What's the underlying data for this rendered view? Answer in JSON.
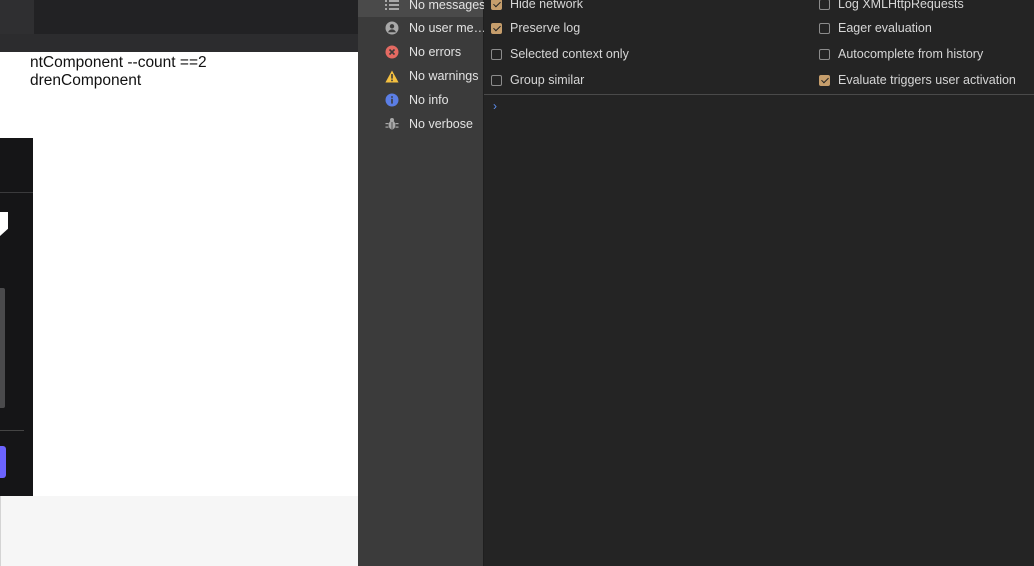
{
  "webpage": {
    "lines": [
      "ntComponent --count ==2",
      "drenComponent"
    ]
  },
  "console_sidebar": {
    "items": [
      {
        "label": "No messages",
        "icon": "list-icon"
      },
      {
        "label": "No user me…",
        "icon": "user-icon"
      },
      {
        "label": "No errors",
        "icon": "error-icon"
      },
      {
        "label": "No warnings",
        "icon": "warning-icon"
      },
      {
        "label": "No info",
        "icon": "info-icon"
      },
      {
        "label": "No verbose",
        "icon": "bug-icon"
      }
    ]
  },
  "settings": {
    "left": [
      {
        "label": "Hide network",
        "checked": true
      },
      {
        "label": "Preserve log",
        "checked": true
      },
      {
        "label": "Selected context only",
        "checked": false
      },
      {
        "label": "Group similar",
        "checked": false
      }
    ],
    "right": [
      {
        "label": "Log XMLHttpRequests",
        "checked": false
      },
      {
        "label": "Eager evaluation",
        "checked": false
      },
      {
        "label": "Autocomplete from history",
        "checked": false
      },
      {
        "label": "Evaluate triggers user activation",
        "checked": true
      }
    ]
  },
  "console": {
    "prompt_symbol": "›"
  },
  "colors": {
    "checkbox_checked": "#c69e6c",
    "prompt": "#5d8ff2",
    "error": "#e46a62",
    "warning": "#f4c040",
    "info": "#5b7ee5"
  }
}
